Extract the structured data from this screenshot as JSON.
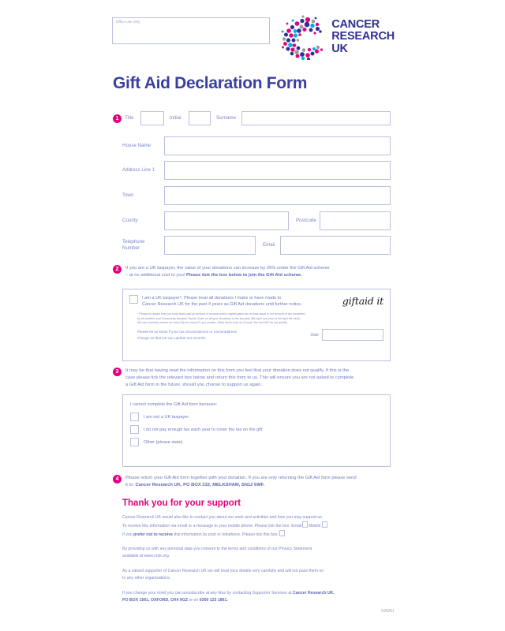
{
  "header": {
    "office_use_label": "Office use only",
    "logo_line1": "CANCER",
    "logo_line2": "RESEARCH",
    "logo_line3": "UK"
  },
  "title": "Gift Aid Declaration Form",
  "colors": {
    "brand_purple": "#2e3192",
    "brand_pink": "#e6007e",
    "field_border": "#b9c0e0",
    "body_text": "#6e7abd"
  },
  "steps": {
    "one": "1",
    "two": "2",
    "three": "3",
    "four": "4"
  },
  "fields": {
    "title": "Title",
    "initial": "Initial",
    "surname": "Surname",
    "house_name": "House Name",
    "address_line_1": "Address Line 1",
    "town": "Town",
    "county": "County",
    "postcode": "Postcode",
    "telephone": "Telephone\nNumber",
    "telephone_l1": "Telephone",
    "telephone_l2": "Number",
    "email": "Email",
    "date": "Date"
  },
  "section2": {
    "line1": "If you are a UK taxpayer, the value of your donations can increase by 25% under the Gift Aid scheme",
    "line2_plain": "– at no additional cost to you! ",
    "line2_bold": "Please tick the box below to join the Gift Aid scheme."
  },
  "giftaid_panel": {
    "declaration_line1": "I am a UK taxpayer*.  Please treat all donations I make or have made to",
    "declaration_line2": "Cancer Research UK for the past 4 years as Gift Aid donations until further notice.",
    "giftaid_logo": "giftaid it",
    "fineprint_line1": "* Please be aware that you must have paid an amount of income and/or capital gains tax at least equal to the amount of tax reclaimed",
    "fineprint_line2": "by all charities and Community Amateur Sports Clubs on all your donations in the tax year (6th April one year to 5th April the next).",
    "fineprint_line3": "We can currently receive an extra 25p for every £1 you donate. Other taxes such as Council Tax and VAT do not qualify.",
    "update_line1": "Please let us know if your tax circumstances or name/address",
    "update_line2": "change so that we can update our records."
  },
  "section3": {
    "line1": "It may be that having read the information on this form you feel that your donation does not qualify. If this is the",
    "line2": "case please tick the relevant box below and return this form to us. This will ensure you are not asked to complete",
    "line3": "a Gift Aid form in the future, should you choose to support us again."
  },
  "nonqualify_panel": {
    "heading": "I cannot complete the Gift Aid form because:",
    "options": [
      "I am not a UK taxpayer",
      "I do not pay enough tax each year to cover the tax on the gift",
      "Other (please state)"
    ]
  },
  "section4": {
    "line1": "Please return your Gift Aid form together with your donation. If you are only returning the Gift Aid form please send",
    "line2_plain": "it to: ",
    "line2_bold": "Cancer Research UK, PO BOX 232, MELKSHAM, SN12 6WF."
  },
  "thank_you": "Thank you for your support",
  "footer": {
    "contact_line1": "Cancer Research UK would also like to contact you about our work and activities and how you may support us.",
    "contact_line2a": "To receive this information via email or a message to your mobile phone. Please tick the box: Email",
    "contact_line2b": "Mobile",
    "prefer_not_a": "If you ",
    "prefer_not_b": "prefer not to receive",
    "prefer_not_c": " this information by post or telephone. Please tick this box:",
    "privacy_line1": "By providing us with any personal data you consent to the terms and conditions of our Privacy Statement",
    "privacy_line2": "available at www.cruk.org.",
    "valued_line1": "As a valued supporter of Cancer Research UK we will treat your details very carefully and will not pass them on",
    "valued_line2": "to any other organisations.",
    "unsub_line1a": "If you change your mind you can unsubscribe at any time by contacting Supporter Services at ",
    "unsub_line1b": "Cancer Research UK,",
    "unsub_line2a": "PO BOX 1561, OXFORD, OX4 9GZ",
    "unsub_line2b": " or on ",
    "unsub_line2c": "0300 123 1861.",
    "reference_code": "GAD01"
  }
}
